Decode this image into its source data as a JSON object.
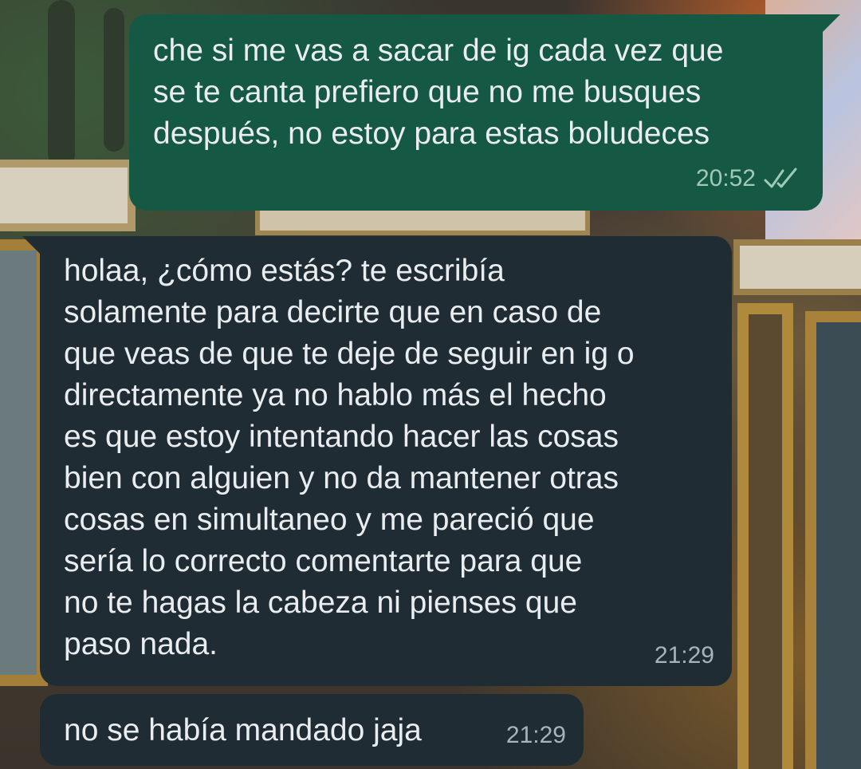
{
  "colors": {
    "outgoing_bubble": "#155843",
    "incoming_bubble": "#202c33",
    "message_text": "#e9edef",
    "timestamp_text": "#a8b3ba"
  },
  "messages": [
    {
      "direction": "outgoing",
      "text": "che si me vas a sacar de ig cada vez que\nse te canta prefiero que no me busques\ndespués, no estoy para estas boludeces",
      "time": "20:52",
      "status_icon": "double-check-icon"
    },
    {
      "direction": "incoming",
      "text": "holaa, ¿cómo estás? te escribía\nsolamente para decirte que en caso de\nque veas de que te deje de seguir en ig o\ndirectamente ya no hablo más el hecho\nes que estoy intentando hacer las cosas\nbien con alguien y no da mantener otras\ncosas en simultaneo y me pareció que\nsería lo correcto comentarte para que\nno te hagas la cabeza ni pienses que\npaso nada.",
      "time": "21:29"
    },
    {
      "direction": "incoming",
      "text": "no se había mandado jaja",
      "time": "21:29"
    }
  ]
}
